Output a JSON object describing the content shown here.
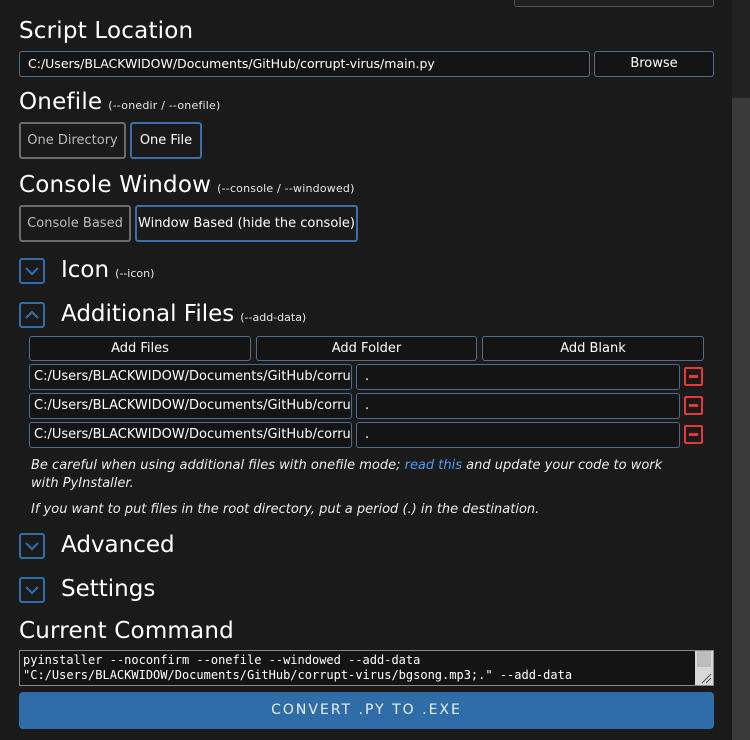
{
  "script_location": {
    "title": "Script Location",
    "path": "C:/Users/BLACKWIDOW/Documents/GitHub/corrupt-virus/main.py",
    "browse_label": "Browse"
  },
  "onefile": {
    "title": "Onefile",
    "hint": "(--onedir / --onefile)",
    "option_directory": "One Directory",
    "option_file": "One File",
    "selected": "One File"
  },
  "console_window": {
    "title": "Console Window",
    "hint": "(--console / --windowed)",
    "option_console": "Console Based",
    "option_window": "Window Based (hide the console)",
    "selected": "Window Based (hide the console)"
  },
  "icon_section": {
    "title": "Icon",
    "hint": "(--icon)",
    "expanded": false
  },
  "additional_files": {
    "title": "Additional Files",
    "hint": "(--add-data)",
    "expanded": true,
    "add_files_label": "Add Files",
    "add_folder_label": "Add Folder",
    "add_blank_label": "Add Blank",
    "rows": [
      {
        "source": "C:/Users/BLACKWIDOW/Documents/GitHub/corrupt",
        "destination": "."
      },
      {
        "source": "C:/Users/BLACKWIDOW/Documents/GitHub/corrupt",
        "destination": "."
      },
      {
        "source": "C:/Users/BLACKWIDOW/Documents/GitHub/corrupt",
        "destination": "."
      }
    ],
    "note1_before": "Be careful when using additional files with onefile mode; ",
    "note1_link": "read this",
    "note1_after": " and update your code to work with PyInstaller.",
    "note2": "If you want to put files in the root directory, put a period (.) in the destination."
  },
  "advanced_section": {
    "title": "Advanced",
    "expanded": false
  },
  "settings_section": {
    "title": "Settings",
    "expanded": false
  },
  "current_command": {
    "title": "Current Command",
    "text": "pyinstaller --noconfirm --onefile --windowed --add-data\n\"C:/Users/BLACKWIDOW/Documents/GitHub/corrupt-virus/bgsong.mp3;.\" --add-data"
  },
  "convert_label": "CONVERT .PY TO .EXE",
  "colors": {
    "accent": "#2f6da8",
    "selected_border": "#3b6fa7",
    "remove_red": "#e23a3a",
    "link": "#4f9cf0"
  }
}
